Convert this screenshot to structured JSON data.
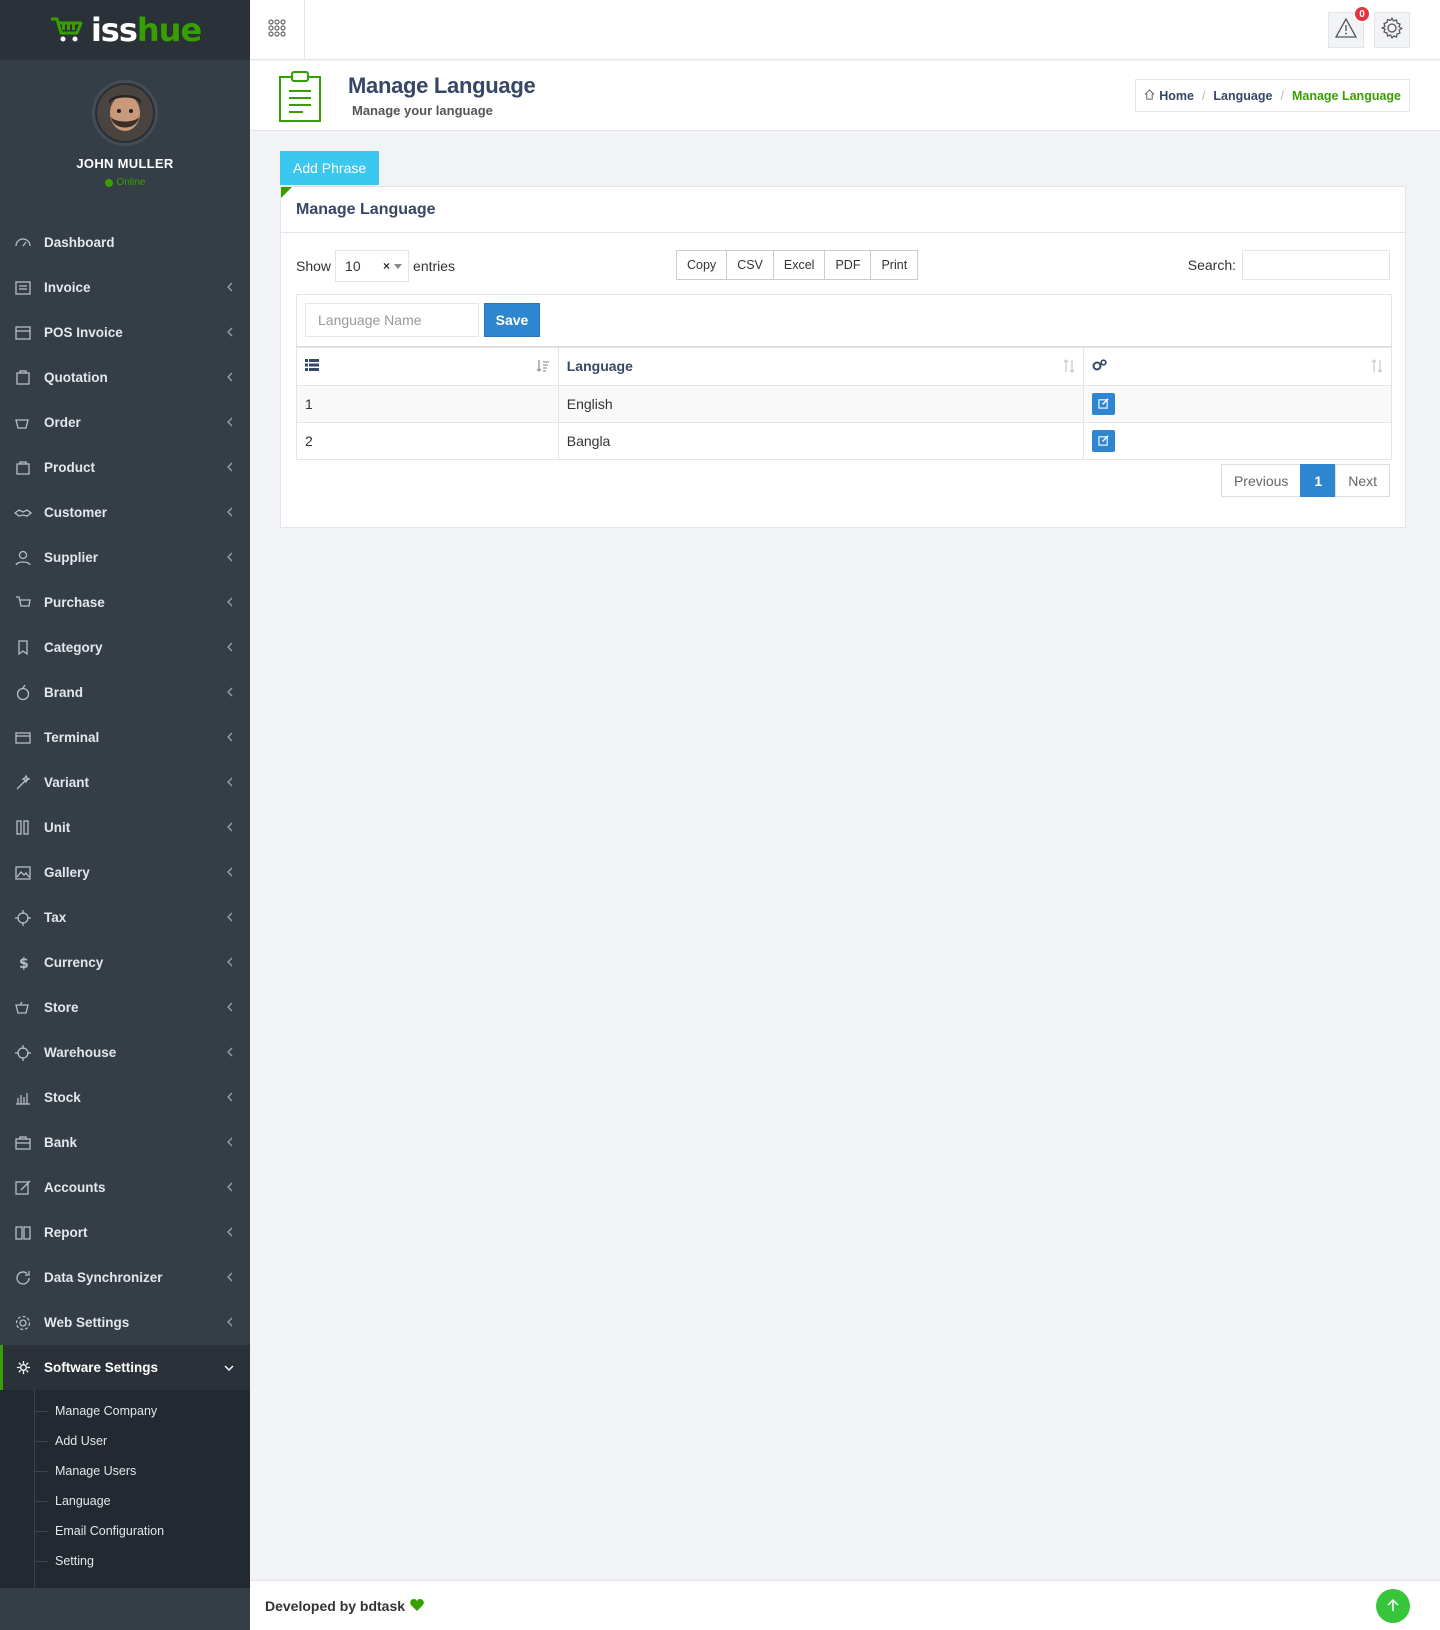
{
  "brand": {
    "part1": "iss",
    "part2": "hue"
  },
  "user": {
    "name": "JOHN MULLER",
    "status": "Online"
  },
  "sidebar": {
    "items": [
      {
        "label": "Dashboard",
        "icon": "dashboard-icon",
        "chevron": false
      },
      {
        "label": "Invoice",
        "icon": "invoice-icon",
        "chevron": true
      },
      {
        "label": "POS Invoice",
        "icon": "pos-invoice-icon",
        "chevron": true
      },
      {
        "label": "Quotation",
        "icon": "quotation-icon",
        "chevron": true
      },
      {
        "label": "Order",
        "icon": "order-icon",
        "chevron": true
      },
      {
        "label": "Product",
        "icon": "product-icon",
        "chevron": true
      },
      {
        "label": "Customer",
        "icon": "customer-icon",
        "chevron": true
      },
      {
        "label": "Supplier",
        "icon": "supplier-icon",
        "chevron": true
      },
      {
        "label": "Purchase",
        "icon": "purchase-icon",
        "chevron": true
      },
      {
        "label": "Category",
        "icon": "category-icon",
        "chevron": true
      },
      {
        "label": "Brand",
        "icon": "brand-icon",
        "chevron": true
      },
      {
        "label": "Terminal",
        "icon": "terminal-icon",
        "chevron": true
      },
      {
        "label": "Variant",
        "icon": "variant-icon",
        "chevron": true
      },
      {
        "label": "Unit",
        "icon": "unit-icon",
        "chevron": true
      },
      {
        "label": "Gallery",
        "icon": "gallery-icon",
        "chevron": true
      },
      {
        "label": "Tax",
        "icon": "tax-icon",
        "chevron": true
      },
      {
        "label": "Currency",
        "icon": "currency-icon",
        "chevron": true
      },
      {
        "label": "Store",
        "icon": "store-icon",
        "chevron": true
      },
      {
        "label": "Warehouse",
        "icon": "warehouse-icon",
        "chevron": true
      },
      {
        "label": "Stock",
        "icon": "stock-icon",
        "chevron": true
      },
      {
        "label": "Bank",
        "icon": "bank-icon",
        "chevron": true
      },
      {
        "label": "Accounts",
        "icon": "accounts-icon",
        "chevron": true
      },
      {
        "label": "Report",
        "icon": "report-icon",
        "chevron": true
      },
      {
        "label": "Data Synchronizer",
        "icon": "sync-icon",
        "chevron": true
      },
      {
        "label": "Web Settings",
        "icon": "web-settings-icon",
        "chevron": true
      }
    ],
    "active": {
      "label": "Software Settings",
      "icon": "gear-icon"
    },
    "submenu": [
      "Manage Company",
      "Add User",
      "Manage Users",
      "Language",
      "Email Configuration",
      "Setting"
    ]
  },
  "topbar": {
    "alert_count": "0"
  },
  "page": {
    "title": "Manage Language",
    "subtitle": "Manage your language"
  },
  "breadcrumb": {
    "home": "Home",
    "parent": "Language",
    "current": "Manage Language"
  },
  "add_phrase_label": "Add Phrase",
  "panel": {
    "title": "Manage Language",
    "show_label": "Show",
    "entries_value": "10",
    "entries_label": "entries",
    "export_buttons": [
      "Copy",
      "CSV",
      "Excel",
      "PDF",
      "Print"
    ],
    "search_label": "Search:",
    "language_placeholder": "Language Name",
    "save_label": "Save",
    "columns": {
      "language": "Language"
    },
    "rows": [
      {
        "sl": "1",
        "language": "English"
      },
      {
        "sl": "2",
        "language": "Bangla"
      }
    ],
    "pagination": {
      "previous": "Previous",
      "current": "1",
      "next": "Next"
    }
  },
  "footer": {
    "text": "Developed by bdtask"
  },
  "colors": {
    "accent": "#37a000",
    "sidebar_bg": "#353d46",
    "primary": "#2f86d0",
    "info": "#3bc8f0"
  }
}
